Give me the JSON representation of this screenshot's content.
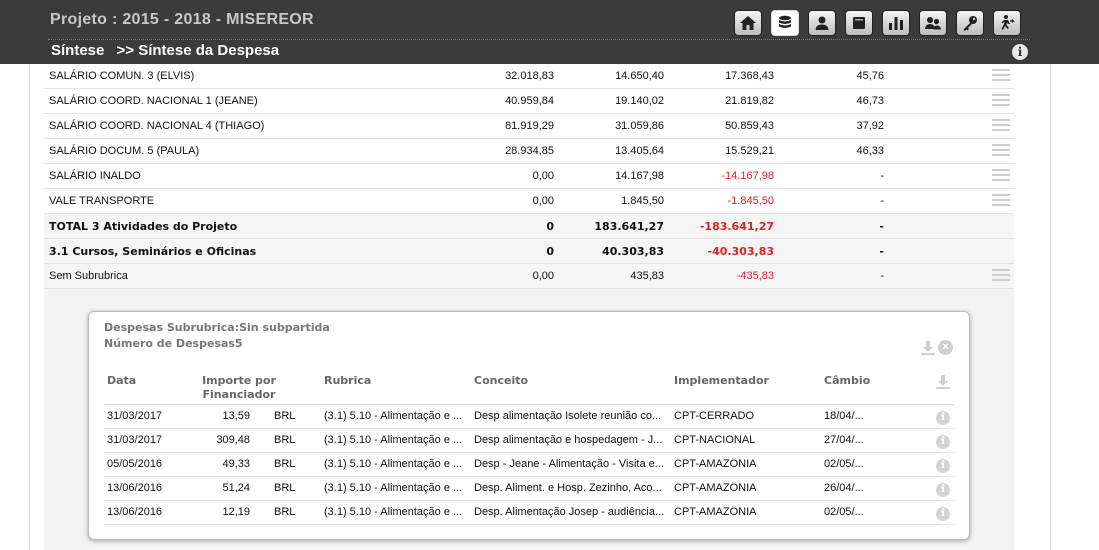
{
  "header": {
    "title": "Projeto : 2015 - 2018 - MISEREOR",
    "breadcrumb": [
      "Síntese",
      ">> Síntese da Despesa"
    ],
    "info_icon_label": "i",
    "icons": [
      "home-icon",
      "database-icon",
      "user-icon",
      "book-icon",
      "bar-chart-icon",
      "users-icon",
      "key-icon",
      "exit-icon"
    ]
  },
  "main_rows": [
    {
      "name": "SALÁRIO COMUN. 3 (ELVIS)",
      "v1": "32.018,83",
      "v2": "14.650,40",
      "v3": "17.368,43",
      "v4": "45,76",
      "neg": false,
      "bold": false,
      "icon": true
    },
    {
      "name": "SALÁRIO COORD. NACIONAL 1 (JEANE)",
      "v1": "40.959,84",
      "v2": "19.140,02",
      "v3": "21.819,82",
      "v4": "46,73",
      "neg": false,
      "bold": false,
      "icon": true
    },
    {
      "name": "SALÁRIO COORD. NACIONAL 4 (THIAGO)",
      "v1": "81.919,29",
      "v2": "31.059,86",
      "v3": "50.859,43",
      "v4": "37,92",
      "neg": false,
      "bold": false,
      "icon": true
    },
    {
      "name": "SALÁRIO DOCUM. 5 (PAULA)",
      "v1": "28.934,85",
      "v2": "13.405,64",
      "v3": "15.529,21",
      "v4": "46,33",
      "neg": false,
      "bold": false,
      "icon": true
    },
    {
      "name": "SALÁRIO INALDO",
      "v1": "0,00",
      "v2": "14.167,98",
      "v3": "-14.167,98",
      "v4": "-",
      "neg": true,
      "bold": false,
      "icon": true
    },
    {
      "name": "VALE TRANSPORTE",
      "v1": "0,00",
      "v2": "1.845,50",
      "v3": "-1.845,50",
      "v4": "-",
      "neg": true,
      "bold": false,
      "icon": true
    },
    {
      "name": "TOTAL 3 Atividades do Projeto",
      "v1": "0",
      "v2": "183.641,27",
      "v3": "-183.641,27",
      "v4": "-",
      "neg": true,
      "bold": true,
      "icon": false
    },
    {
      "name": "3.1 Cursos, Seminários e Oficinas",
      "v1": "0",
      "v2": "40.303,83",
      "v3": "-40.303,83",
      "v4": "-",
      "neg": true,
      "bold": true,
      "icon": false
    },
    {
      "name": "Sem Subrubrica",
      "v1": "0,00",
      "v2": "435,83",
      "v3": "-435,83",
      "v4": "-",
      "neg": true,
      "bold": false,
      "icon": true
    }
  ],
  "sub": {
    "title": "Despesas Subrubrica:Sin subpartida",
    "count": "Número de Despesas5",
    "columns": {
      "date": "Data",
      "importe": "Importe por Financiador",
      "rubrica": "Rubrica",
      "conceito": "Conceito",
      "implementador": "Implementador",
      "cambio": "Câmbio"
    },
    "rows": [
      {
        "date": "31/03/2017",
        "amount": "13,59",
        "currency": "BRL",
        "rubrica": "(3.1) 5.10 - Alimentação e ...",
        "conceito": "Desp alimentação Isolete reunião co...",
        "impl": "CPT-CERRADO",
        "cambio": "18/04/..."
      },
      {
        "date": "31/03/2017",
        "amount": "309,48",
        "currency": "BRL",
        "rubrica": "(3.1) 5.10 - Alimentação e ...",
        "conceito": "Desp alimentação e hospedagem - J...",
        "impl": "CPT-NACIONAL",
        "cambio": "27/04/..."
      },
      {
        "date": "05/05/2016",
        "amount": "49,33",
        "currency": "BRL",
        "rubrica": "(3.1) 5.10 - Alimentação e ...",
        "conceito": "Desp - Jeane - Alimentação - Visita e...",
        "impl": "CPT-AMAZÔNIA",
        "cambio": "02/05/..."
      },
      {
        "date": "13/06/2016",
        "amount": "51,24",
        "currency": "BRL",
        "rubrica": "(3.1) 5.10 - Alimentação e ...",
        "conceito": "Desp. Aliment. e Hosp. Zezinho, Aco...",
        "impl": "CPT-AMAZÔNIA",
        "cambio": "26/04/..."
      },
      {
        "date": "13/06/2016",
        "amount": "12,19",
        "currency": "BRL",
        "rubrica": "(3.1) 5.10 - Alimentação e ...",
        "conceito": "Desp. Alimentação Josep - audiência...",
        "impl": "CPT-AMAZÔNIA",
        "cambio": "02/05/..."
      }
    ],
    "row_info_label": "i",
    "close_label": "×"
  },
  "colors": {
    "topbar": "#3b3b3b",
    "negative": "#e02020"
  }
}
